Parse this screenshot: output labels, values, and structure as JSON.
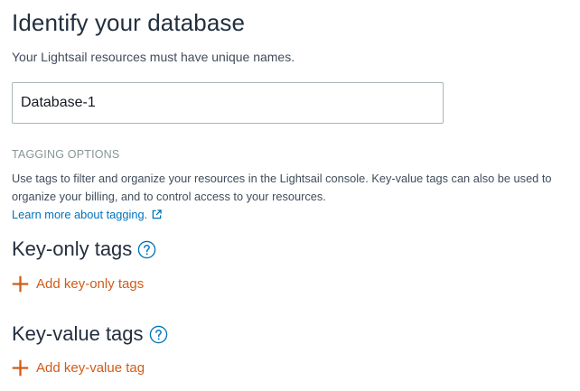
{
  "header": {
    "title": "Identify your database",
    "subtitle": "Your Lightsail resources must have unique names."
  },
  "name_field": {
    "value": "Database-1"
  },
  "tagging": {
    "section_label": "TAGGING OPTIONS",
    "description": "Use tags to filter and organize your resources in the Lightsail console. Key-value tags can also be used to organize your billing, and to control access to your resources.",
    "learn_more_label": "Learn more about tagging.",
    "learn_more_icon": "external-link-icon"
  },
  "key_only_tags": {
    "heading": "Key-only tags",
    "help_icon": "help-circle-icon",
    "add_label": "Add key-only tags",
    "add_icon": "plus-icon"
  },
  "key_value_tags": {
    "heading": "Key-value tags",
    "help_icon": "help-circle-icon",
    "add_label": "Add key-value tag",
    "add_icon": "plus-icon"
  },
  "colors": {
    "text_dark": "#232f3e",
    "text_body": "#414d5c",
    "label_gray": "#879596",
    "link_blue": "#0073bb",
    "accent_orange": "#d05c17",
    "input_border": "#aab7b8"
  }
}
